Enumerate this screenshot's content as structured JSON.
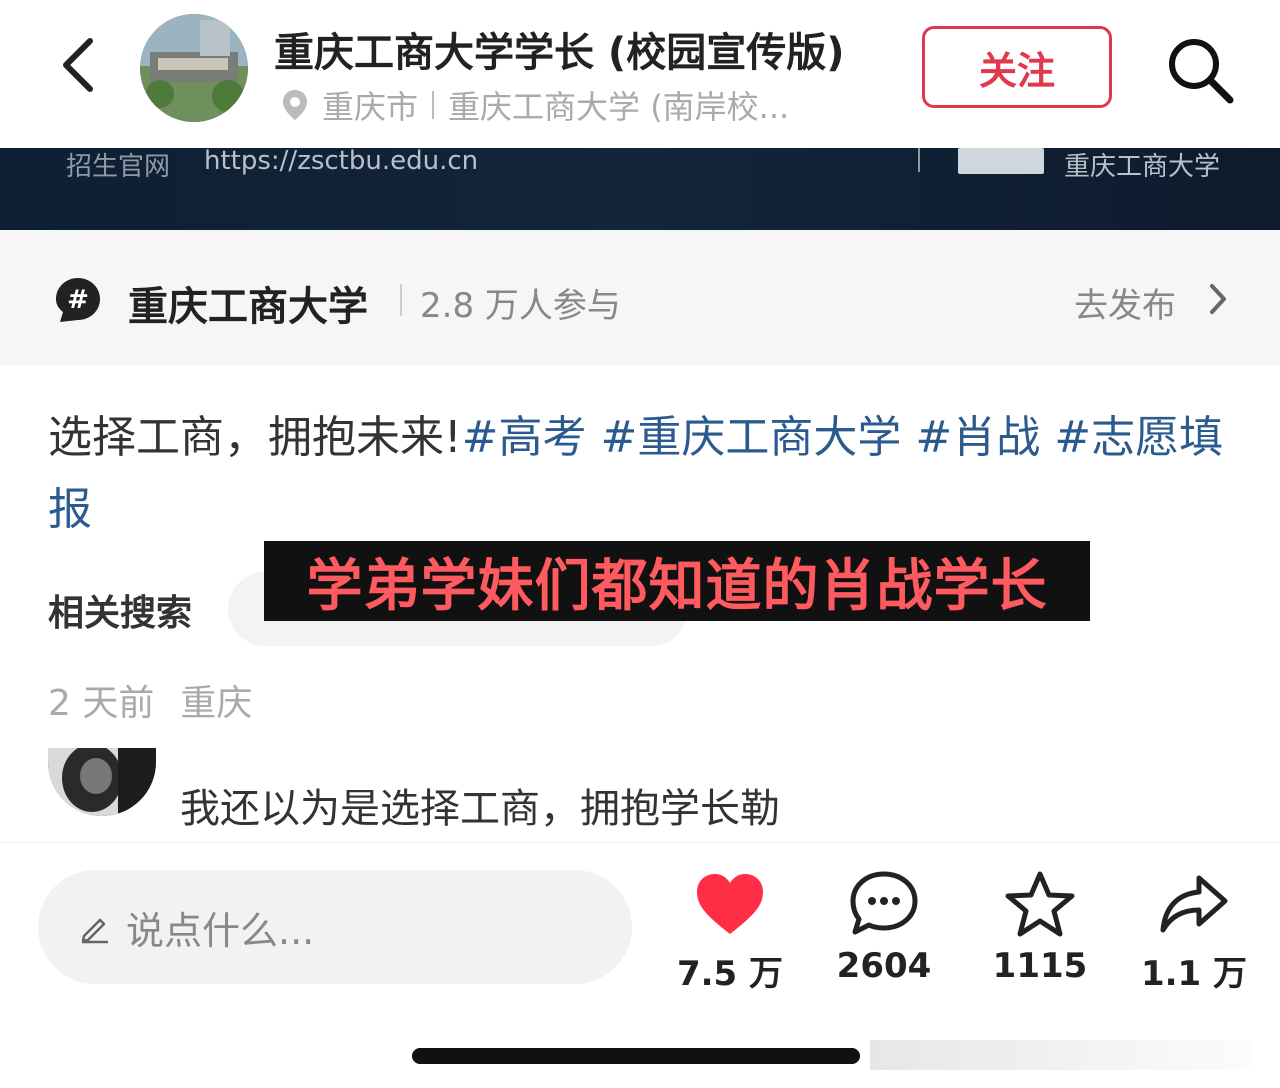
{
  "header": {
    "title": "重庆工商大学学长 (校园宣传版)",
    "location_city": "重庆市",
    "location_place": "重庆工商大学 (南岸校...",
    "follow_label": "关注",
    "icons": {
      "back": "back-arrow-icon",
      "search": "search-icon",
      "location": "location-pin-icon"
    }
  },
  "banner": {
    "label": "招生官网",
    "url": "https://zsctbu.edu.cn",
    "right_text": "重庆工商大学"
  },
  "topic": {
    "icon": "hashtag-icon",
    "name": "重庆工商大学",
    "participants": "2.8 万人参与",
    "action": "去发布"
  },
  "post": {
    "text": "选择工商，拥抱未来!",
    "tags": [
      "#高考",
      "#重庆工商大学",
      "#肖战",
      "#志愿填报"
    ],
    "related_label": "相关搜索",
    "overlay_caption": "学弟学妹们都知道的肖战学长",
    "time": "2 天前",
    "place": "重庆"
  },
  "comment": {
    "text": "我还以为是选择工商，拥抱学长勒"
  },
  "bottom": {
    "input_placeholder": "说点什么...",
    "likes": "7.5 万",
    "comments": "2604",
    "favorites": "1115",
    "shares": "1.1 万"
  },
  "colors": {
    "accent": "#e0384c",
    "like": "#ff2d46",
    "tag": "#2b5a8f",
    "caption": "#ff5a5f",
    "banner_bg": "#0e1f33"
  }
}
